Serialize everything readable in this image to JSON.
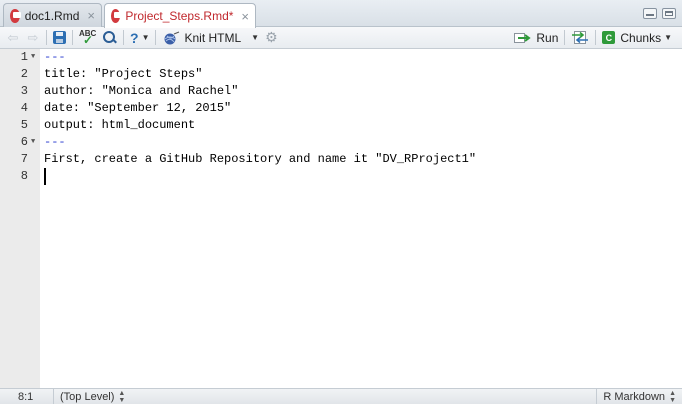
{
  "tabs": [
    {
      "label": "doc1.Rmd",
      "active": false
    },
    {
      "label": "Project_Steps.Rmd*",
      "active": true
    }
  ],
  "toolbar": {
    "knit_label": "Knit HTML",
    "run_label": "Run",
    "chunks_label": "Chunks",
    "chunks_badge": "C",
    "abc_label": "ABC"
  },
  "editor": {
    "lines": [
      {
        "num": "1",
        "text": "---",
        "fold": true,
        "style": "dashes"
      },
      {
        "num": "2",
        "text": "title: \"Project Steps\"",
        "fold": false,
        "style": "normal"
      },
      {
        "num": "3",
        "text": "author: \"Monica and Rachel\"",
        "fold": false,
        "style": "normal"
      },
      {
        "num": "4",
        "text": "date: \"September 12, 2015\"",
        "fold": false,
        "style": "normal"
      },
      {
        "num": "5",
        "text": "output: html_document",
        "fold": false,
        "style": "normal"
      },
      {
        "num": "6",
        "text": "---",
        "fold": true,
        "style": "dashes"
      },
      {
        "num": "7",
        "text": "First, create a GitHub Repository and name it \"DV_RProject1\"",
        "fold": false,
        "style": "normal"
      },
      {
        "num": "8",
        "text": "",
        "fold": false,
        "style": "normal"
      }
    ]
  },
  "status": {
    "position": "8:1",
    "scope": "(Top Level)",
    "mode": "R Markdown"
  },
  "colors": {
    "active_tab_text": "#c0282d",
    "yaml_dash": "#2b3ccf",
    "gutter_bg": "#ebebeb"
  }
}
